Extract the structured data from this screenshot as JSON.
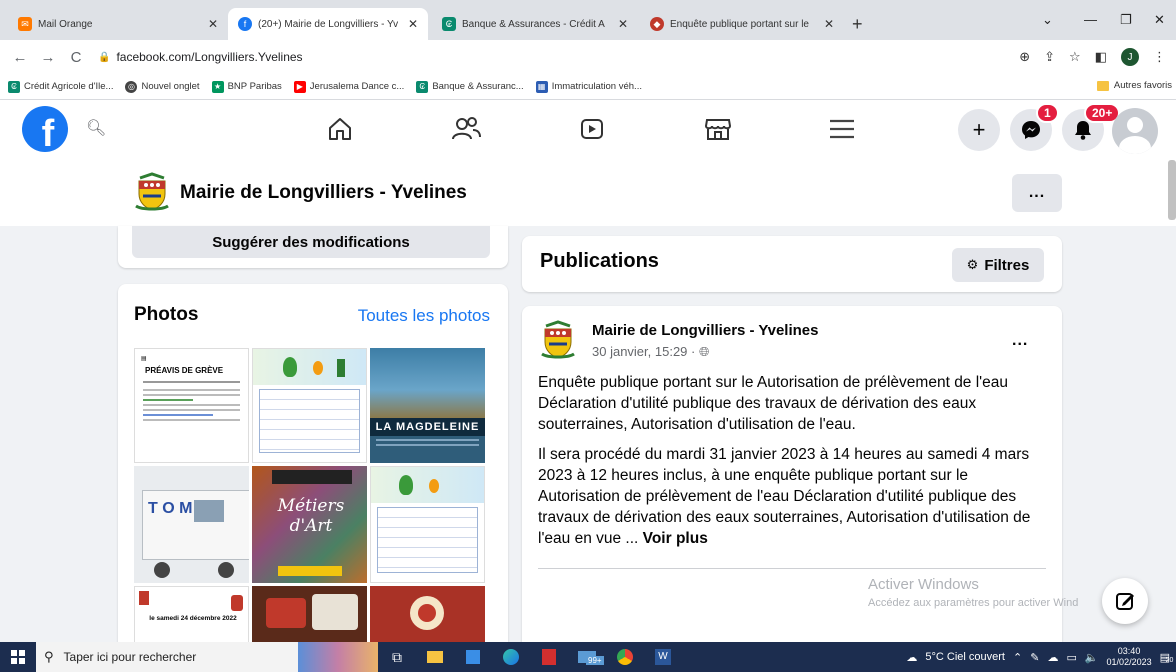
{
  "browser": {
    "tabs": [
      {
        "title": "Mail Orange",
        "favicon": "mail-orange-icon",
        "active": false
      },
      {
        "title": "(20+) Mairie de Longvilliers - Yv",
        "favicon": "facebook-icon",
        "active": true
      },
      {
        "title": "Banque & Assurances - Crédit A",
        "favicon": "credit-agricole-icon",
        "active": false
      },
      {
        "title": "Enquête publique portant sur le",
        "favicon": "crest-icon",
        "active": false
      }
    ],
    "url": "facebook.com/Longvilliers.Yvelines",
    "bookmarks": [
      "Crédit Agricole d'Ile...",
      "Nouvel onglet",
      "BNP Paribas",
      "Jerusalema Dance c...",
      "Banque & Assuranc...",
      "Immatriculation véh..."
    ],
    "bookmarks_other": "Autres favoris",
    "profile_initial": "J"
  },
  "fb": {
    "logo_letter": "f",
    "messenger_badge": "1",
    "notif_badge": "20+"
  },
  "page": {
    "name": "Mairie de Longvilliers - Yvelines",
    "more": "...",
    "suggest_label": "Suggérer des modifications"
  },
  "photos": {
    "title": "Photos",
    "all_link": "Toutes les photos",
    "items": [
      {
        "heading": "PRÉAVIS DE GRÈVE"
      },
      {
        "heading": ""
      },
      {
        "heading": "LA MAGDELEINE"
      },
      {
        "heading": "T O M"
      },
      {
        "heading": "Métiers d'Art"
      },
      {
        "heading": ""
      },
      {
        "heading": "le samedi 24 décembre 2022"
      },
      {
        "heading": ""
      },
      {
        "heading": ""
      }
    ]
  },
  "publications": {
    "title": "Publications",
    "filters_label": "Filtres"
  },
  "post": {
    "author": "Mairie de Longvilliers - Yvelines",
    "time": "30 janvier, 15:29 ·",
    "para1": "Enquête publique portant sur le Autorisation de prélèvement de l'eau Déclaration d'utilité publique des travaux de dérivation des eaux souterraines, Autorisation d'utilisation de l'eau.",
    "para2": "Il sera procédé du mardi 31 janvier 2023 à 14 heures au samedi 4 mars 2023 à 12 heures inclus, à une enquête publique portant sur le Autorisation de prélèvement de l'eau Déclaration d'utilité publique des travaux de dérivation des eaux souterraines, Autorisation d'utilisation de l'eau en vue ...",
    "see_more": "Voir plus"
  },
  "windows": {
    "watermark_title": "Activer Windows",
    "watermark_sub": "Accédez aux paramètres pour activer Wind",
    "search_placeholder": "Taper ici pour rechercher",
    "weather": "5°C Ciel couvert",
    "time": "03:40",
    "date": "01/02/2023",
    "mail_badge": "99+",
    "notif_count": "20"
  },
  "colors": {
    "fb_blue": "#1877f2",
    "badge_red": "#e41e3f",
    "taskbar": "#1c2d4f"
  }
}
